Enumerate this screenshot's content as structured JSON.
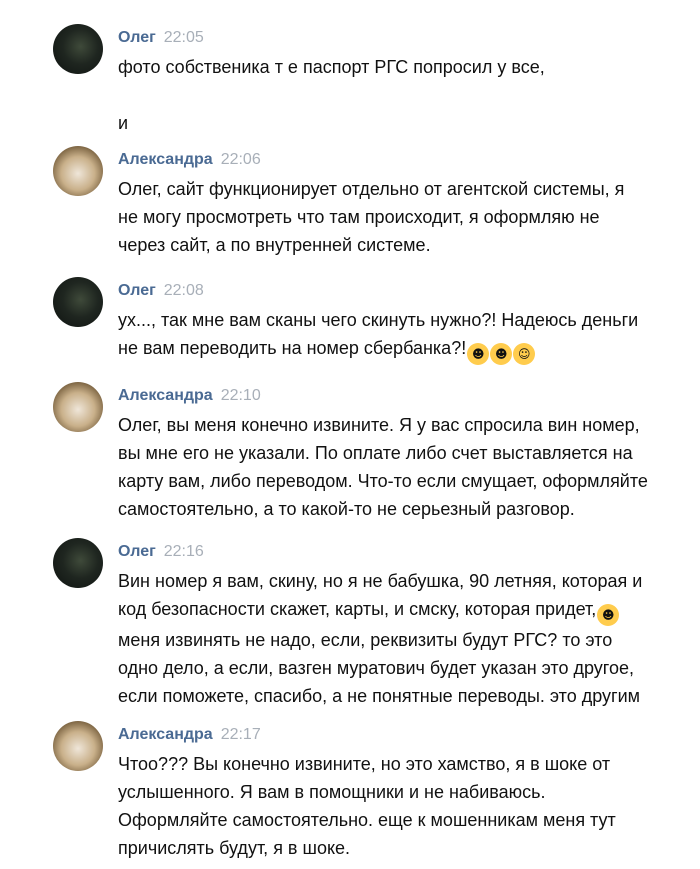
{
  "messages": [
    {
      "author": "Олег",
      "time": "22:05",
      "lines": "фото собственика т е паспорт РГС попросил у все,\n\nи"
    },
    {
      "author": "Александра",
      "time": "22:06",
      "lines": "Олег, сайт функционирует отдельно от агентской системы, я\nне могу просмотреть что там происходит, я оформляю не\nчерез сайт, а по внутренней системе."
    },
    {
      "author": "Олег",
      "time": "22:08",
      "lines": "ух..., так мне вам сканы чего скинуть нужно?! Надеюсь деньги\nне вам переводить на номер сбербанка?!",
      "emojis": [
        "laughing-crying-emoji",
        "face-screaming-emoji",
        "hugging-face-emoji"
      ]
    },
    {
      "author": "Александра",
      "time": "22:10",
      "lines": "Олег, вы меня конечно извините. Я у вас спросила вин номер,\nвы мне его не указали. По оплате либо счет выставляется на\nкарту вам, либо переводом. Что-то если смущает, оформляйте\nсамостоятельно, а то какой-то не серьезный разговор."
    },
    {
      "author": "Олег",
      "time": "22:16",
      "line1": "Вин номер я вам, скину, но я не бабушка, 90 летняя, которая и\nкод безопасности скажет, карты, и смску, которая придет,",
      "line2": "меня извинять не надо, если, реквизиты будут РГС? то это\nодно дело, а если, вазген муратович будет указан это другое,\nесли поможете, спасибо, а не понятные переводы. это другим",
      "emojis": [
        "zany-face-emoji"
      ]
    },
    {
      "author": "Александра",
      "time": "22:17",
      "lines": "Чтоо??? Вы конечно извините, но это хамство, я в шоке от\nуслышенного. Я вам в помощники и не набиваюсь.\nОформляйте самостоятельно. еще к мошенникам меня тут\nпричислять будут, я в шоке."
    }
  ]
}
